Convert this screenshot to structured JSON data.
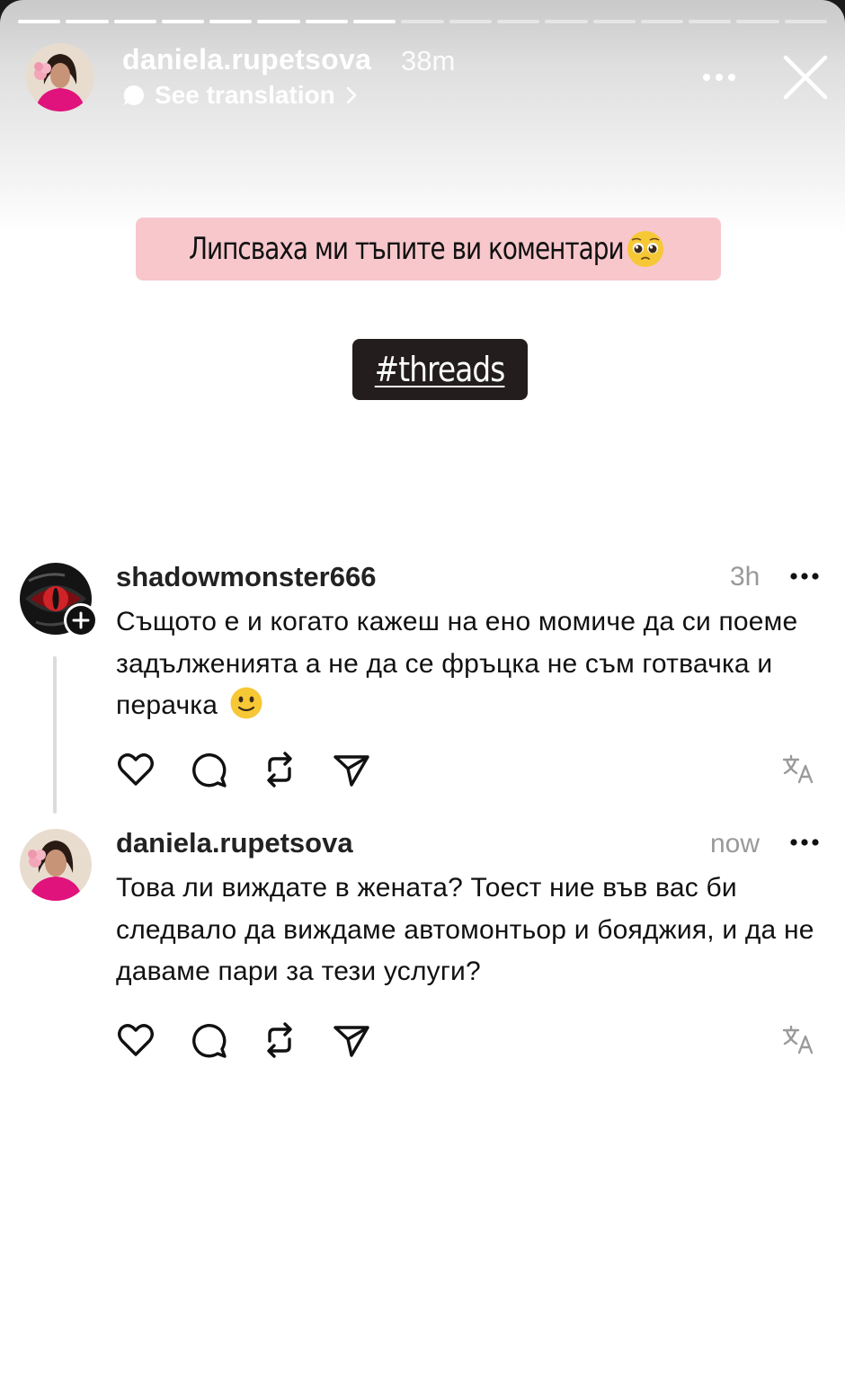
{
  "story": {
    "progress": {
      "total": 17,
      "current": 8
    },
    "username": "daniela.rupetsova",
    "time": "38m",
    "see_translation": "See translation",
    "caption": "Липсваха ми тъпите ви коментари",
    "caption_emoji": "pleading-face-emoji",
    "hashtag": "#threads"
  },
  "posts": [
    {
      "username": "shadowmonster666",
      "time": "3h",
      "text": "Същото е и когато кажеш на ено момиче да си поеме задълженията а не да се фръцка не съм готвачка и перачка",
      "emoji": "slightly-smiling-face-emoji"
    },
    {
      "username": "daniela.rupetsova",
      "time": "now",
      "text": "Това ли виждате в жената? Тоест ние във вас би следвало да виждаме автомонтьор и бояджия, и да не даваме пари за тези услуги?"
    }
  ],
  "colors": {
    "caption_bg": "#f7c7cc",
    "hashtag_bg": "#231d1d",
    "meta_gray": "#999999"
  },
  "icons": [
    "more-icon",
    "close-icon",
    "heart-icon",
    "comment-icon",
    "repost-icon",
    "share-icon",
    "translate-icon",
    "follow-plus-icon"
  ]
}
